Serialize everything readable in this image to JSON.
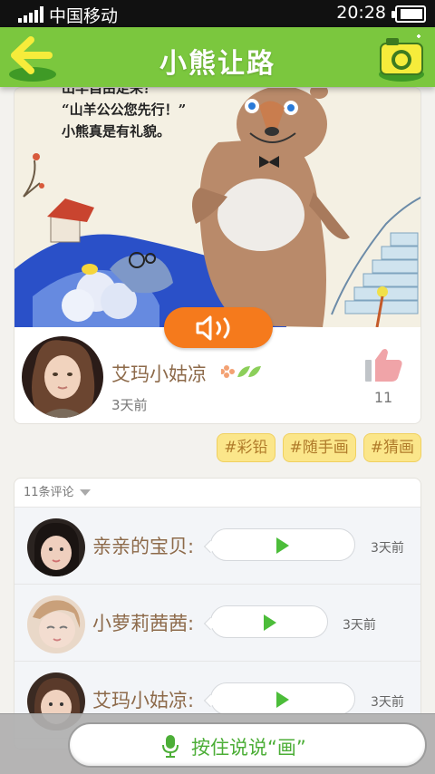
{
  "status_bar": {
    "carrier": "中国移动",
    "time": "20:28"
  },
  "header": {
    "title": "小熊让路"
  },
  "post": {
    "story_lines": [
      "“山羊公公您先行！”",
      "小熊真是有礼貌。"
    ],
    "story_line_top": "山羊自由走来？",
    "author_name": "艾玛小姑凉",
    "time": "3天前",
    "like_count": "11"
  },
  "tags": [
    "#彩铅",
    "#随手画",
    "#猜画"
  ],
  "comments": {
    "header": "11条评论",
    "items": [
      {
        "name": "亲亲的宝贝:",
        "time": "3天前"
      },
      {
        "name": "小萝莉茜茜:",
        "time": "3天前"
      },
      {
        "name": "艾玛小姑凉:",
        "time": "3天前"
      }
    ]
  },
  "bottom": {
    "talk_label": "按住说说“画”"
  },
  "colors": {
    "brand_green": "#7bc73e",
    "accent_orange": "#f57a1c",
    "tag_yellow": "#fbe68a",
    "play_green": "#4cbd3a"
  },
  "icons": [
    "signal-icon",
    "battery-icon",
    "back-arrow-icon",
    "camera-icon",
    "speaker-icon",
    "leaf-icon",
    "thumbs-up-icon",
    "caret-down-icon",
    "play-icon",
    "mic-icon"
  ]
}
